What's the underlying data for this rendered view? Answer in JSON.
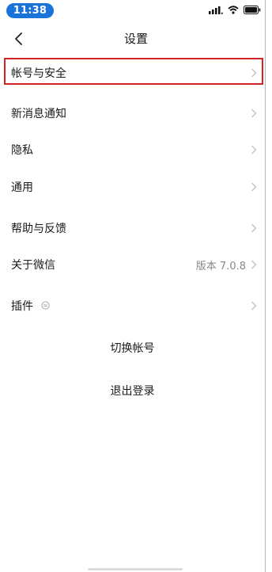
{
  "status_bar": {
    "time": "11:38",
    "signal_icon": "signal-icon",
    "wifi_icon": "wifi-icon",
    "battery_icon": "battery-icon"
  },
  "nav": {
    "title": "设置",
    "back_icon": "back-chevron-icon"
  },
  "menu": {
    "account_security": "帐号与安全",
    "new_message_notification": "新消息通知",
    "privacy": "隐私",
    "general": "通用",
    "help_feedback": "帮助与反馈",
    "about_wechat": "关于微信",
    "version": "版本 7.0.8",
    "plugins": "插件"
  },
  "actions": {
    "switch_account": "切换帐号",
    "logout": "退出登录"
  },
  "colors": {
    "time_pill": "#1a73d9",
    "highlight_border": "#d32323",
    "secondary_text": "#888888",
    "chevron": "#c4c4c4"
  }
}
